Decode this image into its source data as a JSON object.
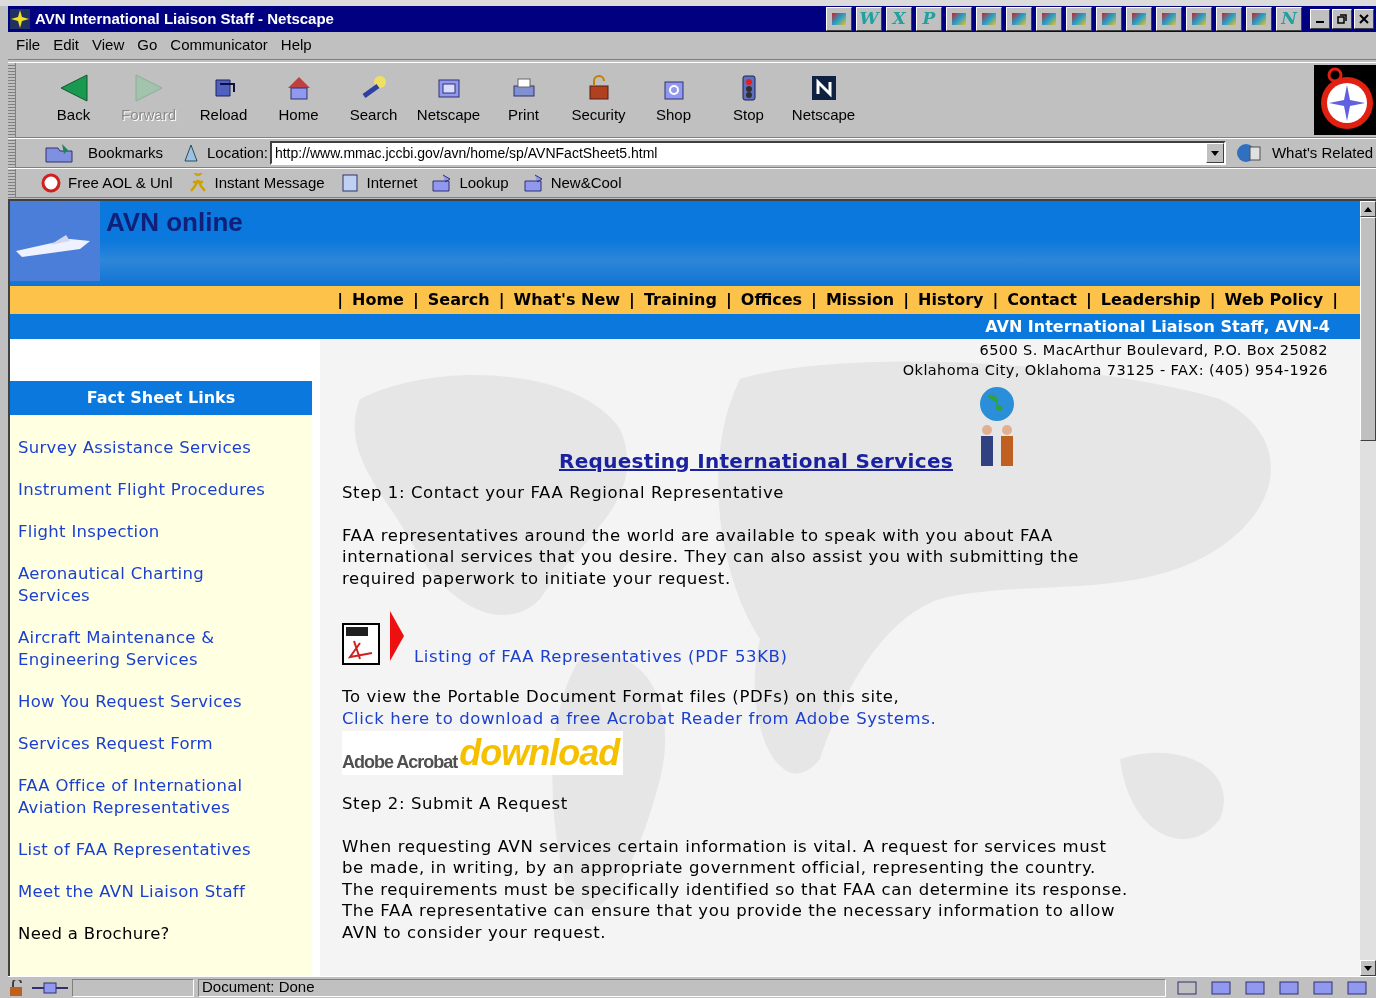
{
  "window": {
    "title": "AVN International Liaison Staff - Netscape"
  },
  "quick_launch": [
    {
      "kind": "tile"
    },
    {
      "kind": "letter",
      "glyph": "W"
    },
    {
      "kind": "letter",
      "glyph": "X"
    },
    {
      "kind": "letter",
      "glyph": "P"
    },
    {
      "kind": "tile"
    },
    {
      "kind": "tile"
    },
    {
      "kind": "tile"
    },
    {
      "kind": "tile"
    },
    {
      "kind": "tile"
    },
    {
      "kind": "tile"
    },
    {
      "kind": "tile"
    },
    {
      "kind": "tile"
    },
    {
      "kind": "tile"
    },
    {
      "kind": "tile"
    },
    {
      "kind": "tile"
    },
    {
      "kind": "letter",
      "glyph": "N"
    }
  ],
  "menu": [
    "File",
    "Edit",
    "View",
    "Go",
    "Communicator",
    "Help"
  ],
  "toolbar": [
    {
      "label": "Back",
      "disabled": false
    },
    {
      "label": "Forward",
      "disabled": true
    },
    {
      "label": "Reload",
      "disabled": false
    },
    {
      "label": "Home",
      "disabled": false
    },
    {
      "label": "Search",
      "disabled": false
    },
    {
      "label": "Netscape",
      "disabled": false
    },
    {
      "label": "Print",
      "disabled": false
    },
    {
      "label": "Security",
      "disabled": false
    },
    {
      "label": "Shop",
      "disabled": false
    },
    {
      "label": "Stop",
      "disabled": false
    },
    {
      "label": "Netscape",
      "disabled": false
    }
  ],
  "location_bar": {
    "bookmarks": "Bookmarks",
    "label": "Location:",
    "url": "http://www.mmac.jccbi.gov/avn/home/sp/AVNFactSheet5.html",
    "related": "What's Related"
  },
  "personal_toolbar": [
    "Free AOL & Unl",
    "Instant Message",
    "Internet",
    "Lookup",
    "New&Cool"
  ],
  "page": {
    "banner_title": "AVN online",
    "nav_separator": "|",
    "nav": [
      "Home",
      "Search",
      "What's New",
      "Training",
      "Offices",
      "Mission",
      "History",
      "Contact",
      "Leadership",
      "Web Policy"
    ],
    "office": "AVN International Liaison Staff, AVN-4",
    "address": [
      "6500 S. MacArthur Boulevard, P.O. Box 25082",
      "Oklahoma City, Oklahoma 73125 - FAX: (405) 954-1926"
    ],
    "sidebar": {
      "title": "Fact Sheet Links",
      "items": [
        {
          "kind": "link",
          "text": "Survey Assistance Services"
        },
        {
          "kind": "link",
          "text": "Instrument Flight Procedures"
        },
        {
          "kind": "link",
          "text": "Flight Inspection"
        },
        {
          "kind": "link",
          "text": "Aeronautical Charting Services"
        },
        {
          "kind": "link",
          "text": "Aircraft Maintenance & Engineering Services"
        },
        {
          "kind": "link",
          "text": "How You Request Services"
        },
        {
          "kind": "link",
          "text": "Services Request Form"
        },
        {
          "kind": "link",
          "text": "FAA Office of International Aviation Representatives"
        },
        {
          "kind": "link",
          "text": "List of FAA Representatives"
        },
        {
          "kind": "link",
          "text": "Meet the AVN Liaison Staff"
        },
        {
          "kind": "text",
          "text": "Need a Brochure?"
        }
      ]
    },
    "heading": "Requesting International Services",
    "step1": "Step 1: Contact your FAA Regional Representative",
    "step1_text": "FAA representatives around the world are available to speak with you about FAA international services that you desire. They can also assist you with submitting the required paperwork to initiate your request.",
    "pdf_link": "Listing of FAA Representatives (PDF 53KB)",
    "pdf_note": "To view the Portable Document Format files (PDFs) on this site,",
    "pdf_note_link": "Click here to download a free Acrobat Reader from Adobe Systems.",
    "acrobat_badge": {
      "brand": "Adobe Acrobat",
      "action": "download"
    },
    "step2": "Step 2: Submit A Request",
    "step2_text": "When requesting AVN services certain information is vital. A request for services must be made, in writing, by an appropriate government official, representing the country. The requirements must be specifically identified so that FAA can determine its response. The FAA representative can ensure that you provide the necessary information to allow AVN to consider your request."
  },
  "status_bar": {
    "text": "Document: Done"
  }
}
